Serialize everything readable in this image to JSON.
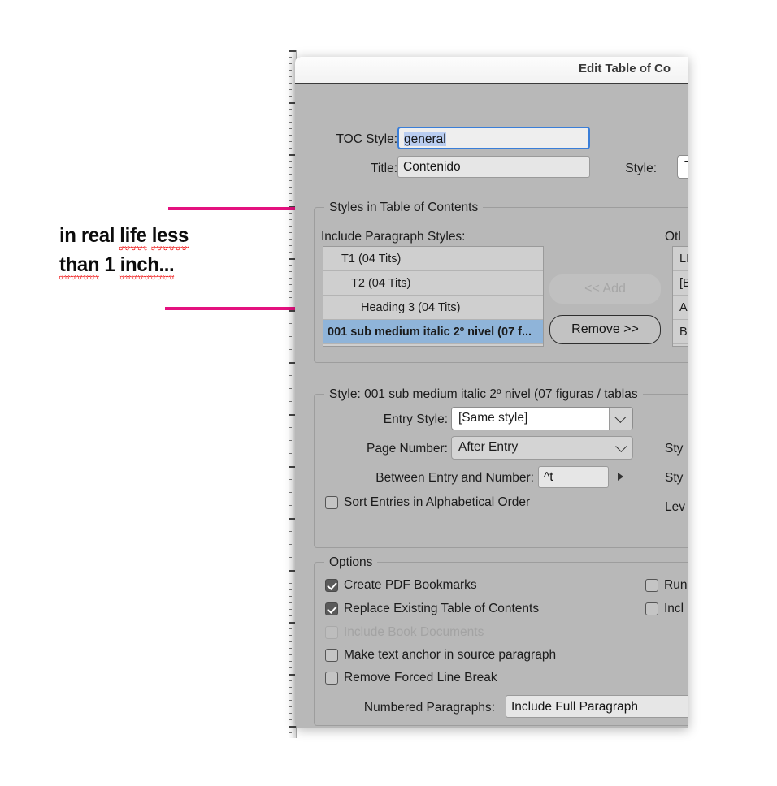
{
  "annotation": {
    "line1": "in real life less",
    "line2": "than 1 inch...",
    "color": "#e4117f"
  },
  "dialog": {
    "title": "Edit Table of Co",
    "toc_style": {
      "label": "TOC Style:",
      "value": "general"
    },
    "title_field": {
      "label": "Title:",
      "value": "Contenido"
    },
    "title_style": {
      "label": "Style:",
      "value": "T"
    },
    "styles_group": {
      "legend": "Styles in Table of Contents",
      "include_label": "Include Paragraph Styles:",
      "other_label": "Otl",
      "include_items": [
        "T1 (04 Tits)",
        "T2 (04 Tits)",
        "Heading 3 (04 Tits)",
        "001 sub medium italic 2º nivel (07 f..."
      ],
      "include_selected_index": 3,
      "other_items": [
        "LIS",
        "[Ba",
        "A b",
        "B T"
      ],
      "add_button": "<< Add",
      "add_enabled": false,
      "remove_button": "Remove >>",
      "remove_enabled": true
    },
    "style_group": {
      "legend": "Style: 001 sub medium italic 2º nivel (07 figuras / tablas",
      "entry_style": {
        "label": "Entry Style:",
        "value": "[Same style]"
      },
      "page_number": {
        "label": "Page Number:",
        "value": "After Entry"
      },
      "between": {
        "label": "Between Entry and Number:",
        "value": "^t"
      },
      "sort_entries": {
        "label": "Sort Entries in Alphabetical Order",
        "checked": false
      },
      "right_labels": [
        "Sty",
        "Sty",
        "Lev"
      ]
    },
    "options_group": {
      "legend": "Options",
      "items": [
        {
          "label": "Create PDF Bookmarks",
          "checked": true,
          "disabled": false
        },
        {
          "label": "Replace Existing Table of Contents",
          "checked": true,
          "disabled": false
        },
        {
          "label": "Include Book Documents",
          "checked": false,
          "disabled": true
        },
        {
          "label": "Make text anchor in source paragraph",
          "checked": false,
          "disabled": false
        },
        {
          "label": "Remove Forced Line Break",
          "checked": false,
          "disabled": false
        }
      ],
      "right_items": [
        {
          "label": "Run",
          "checked": false
        },
        {
          "label": "Incl",
          "checked": false
        }
      ],
      "numbered_paragraphs": {
        "label": "Numbered Paragraphs:",
        "value": "Include Full Paragraph"
      }
    }
  }
}
